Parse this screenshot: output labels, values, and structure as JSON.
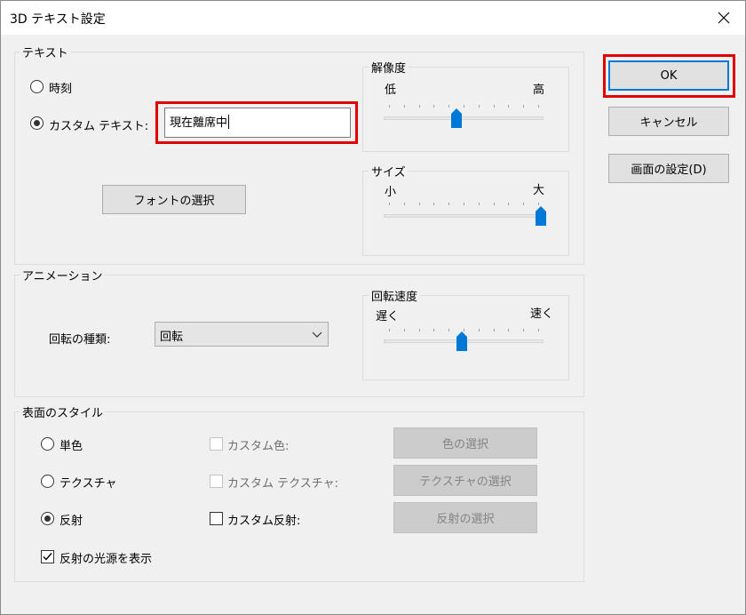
{
  "window": {
    "title": "3D テキスト設定",
    "close_icon": "close-icon"
  },
  "text_group": {
    "legend": "テキスト",
    "time_label": "時刻",
    "custom_text_label": "カスタム テキスト:",
    "custom_text_value": "現在離席中",
    "font_button": "フォントの選択",
    "selected": "custom"
  },
  "resolution": {
    "legend": "解像度",
    "low": "低",
    "high": "高",
    "level": 0.45
  },
  "size": {
    "legend": "サイズ",
    "small": "小",
    "large": "大",
    "level": 1.0
  },
  "animation": {
    "legend": "アニメーション",
    "rotation_type_label": "回転の種類:",
    "rotation_type_value": "回転"
  },
  "rotation_speed": {
    "legend": "回転速度",
    "slow": "遅く",
    "fast": "速く",
    "level": 0.48
  },
  "surface": {
    "legend": "表面のスタイル",
    "solid_label": "単色",
    "texture_label": "テクスチャ",
    "reflection_label": "反射",
    "custom_color_label": "カスタム色:",
    "custom_texture_label": "カスタム テクスチャ:",
    "custom_reflection_label": "カスタム反射:",
    "color_button": "色の選択",
    "texture_button": "テクスチャの選択",
    "reflection_button": "反射の選択",
    "show_light_label": "反射の光源を表示",
    "selected": "reflection",
    "show_light_checked": true
  },
  "buttons": {
    "ok": "OK",
    "cancel": "キャンセル",
    "display_settings": "画面の設定(D)"
  },
  "colors": {
    "accent": "#0078d7",
    "highlight": "#e00000"
  }
}
